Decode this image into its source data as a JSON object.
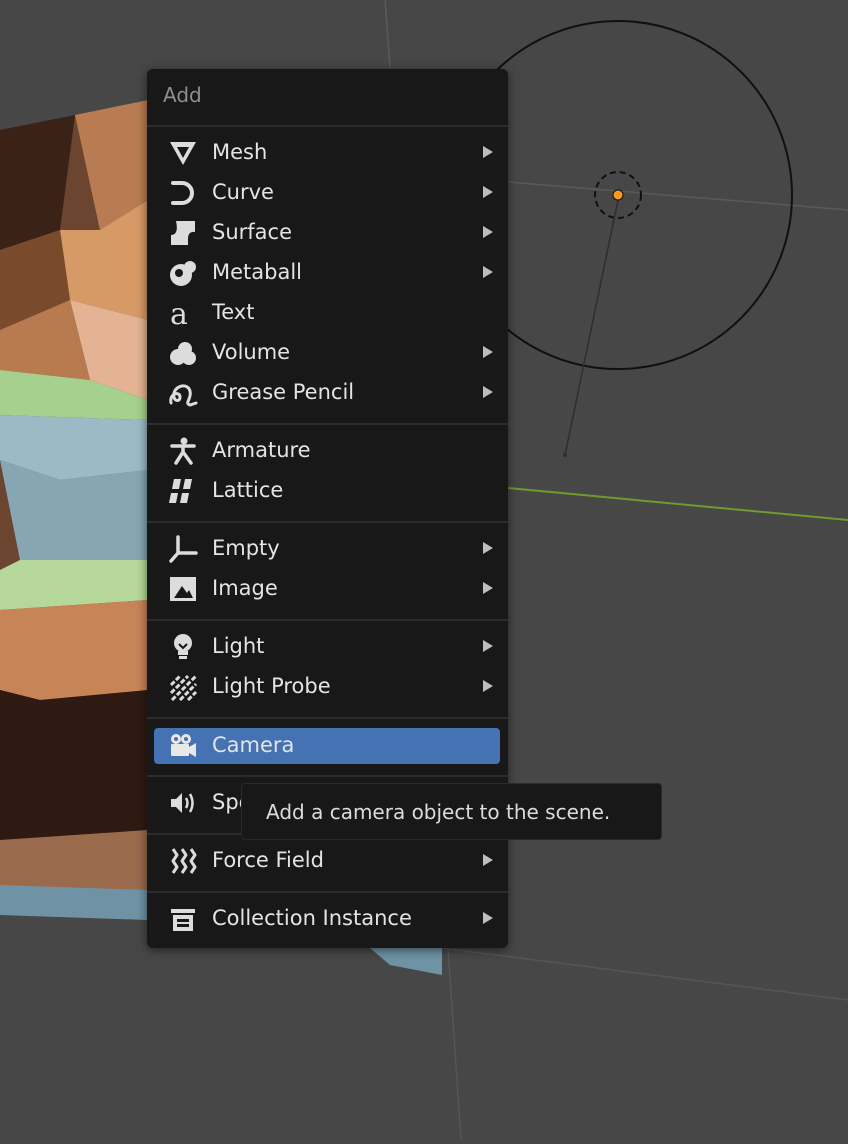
{
  "colors": {
    "viewport_background": "#474747",
    "menu_background": "#181818",
    "highlight": "#4472b3",
    "text": "#e4e4e4",
    "title_text": "#8f8f8f",
    "selected_origin": "#ff9a1e",
    "y_axis_line": "#6e9a2e"
  },
  "menu": {
    "title": "Add",
    "items": [
      {
        "label": "Mesh",
        "icon": "mesh-icon",
        "submenu": true
      },
      {
        "label": "Curve",
        "icon": "curve-icon",
        "submenu": true
      },
      {
        "label": "Surface",
        "icon": "surface-icon",
        "submenu": true
      },
      {
        "label": "Metaball",
        "icon": "metaball-icon",
        "submenu": true
      },
      {
        "label": "Text",
        "icon": "text-icon",
        "submenu": false
      },
      {
        "label": "Volume",
        "icon": "volume-icon",
        "submenu": true
      },
      {
        "label": "Grease Pencil",
        "icon": "grease-pencil-icon",
        "submenu": true
      },
      {
        "label": "Armature",
        "icon": "armature-icon",
        "submenu": false
      },
      {
        "label": "Lattice",
        "icon": "lattice-icon",
        "submenu": false
      },
      {
        "label": "Empty",
        "icon": "empty-icon",
        "submenu": true
      },
      {
        "label": "Image",
        "icon": "image-icon",
        "submenu": true
      },
      {
        "label": "Light",
        "icon": "light-icon",
        "submenu": true
      },
      {
        "label": "Light Probe",
        "icon": "light-probe-icon",
        "submenu": true
      },
      {
        "label": "Camera",
        "icon": "camera-icon",
        "submenu": false,
        "highlighted": true
      },
      {
        "label": "Speaker",
        "icon": "speaker-icon",
        "submenu": false
      },
      {
        "label": "Force Field",
        "icon": "force-field-icon",
        "submenu": true
      },
      {
        "label": "Collection Instance",
        "icon": "collection-instance-icon",
        "submenu": true
      }
    ]
  },
  "tooltip": {
    "text": "Add a camera object to the scene."
  }
}
